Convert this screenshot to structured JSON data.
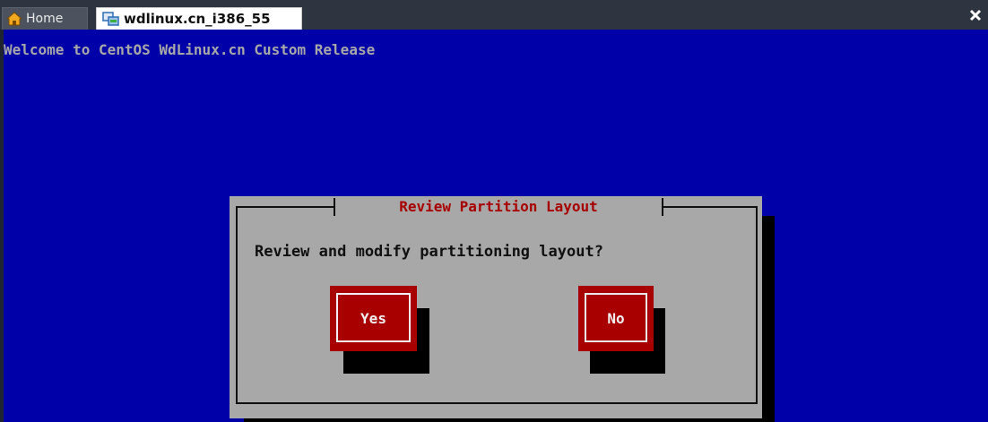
{
  "tabs": {
    "home_label": "Home",
    "vm_label": "wdlinux.cn_i386_55"
  },
  "console": {
    "welcome": "Welcome to CentOS WdLinux.cn Custom Release"
  },
  "dialog": {
    "title": "Review Partition Layout",
    "question": "Review and modify partitioning layout?",
    "yes_label": "Yes",
    "no_label": "No"
  },
  "colors": {
    "console_bg": "#0000a8",
    "dialog_bg": "#a8a8a8",
    "accent_red": "#a80000"
  },
  "icons": [
    "home-icon",
    "vm-icon",
    "close-icon"
  ]
}
